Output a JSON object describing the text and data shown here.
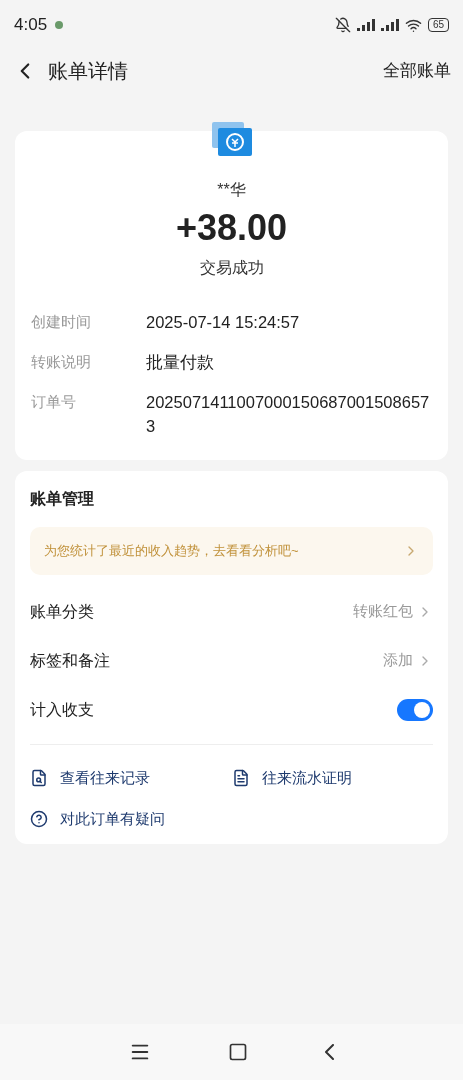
{
  "status_bar": {
    "time": "4:05",
    "battery": "65"
  },
  "header": {
    "title": "账单详情",
    "action": "全部账单"
  },
  "summary": {
    "counterparty": "**华",
    "amount": "+38.00",
    "status": "交易成功",
    "details": [
      {
        "label": "创建时间",
        "value": "2025-07-14 15:24:57"
      },
      {
        "label": "转账说明",
        "value": "批量付款"
      },
      {
        "label": "订单号",
        "value": "20250714110070001506870015086573"
      }
    ]
  },
  "management": {
    "title": "账单管理",
    "banner": "为您统计了最近的收入趋势，去看看分析吧~",
    "rows": [
      {
        "kind": "link",
        "label": "账单分类",
        "value": "转账红包"
      },
      {
        "kind": "link",
        "label": "标签和备注",
        "value": "添加"
      },
      {
        "kind": "toggle",
        "label": "计入收支",
        "on": true
      }
    ],
    "actions": [
      {
        "kind": "records",
        "label": "查看往来记录"
      },
      {
        "kind": "proof",
        "label": "往来流水证明"
      },
      {
        "kind": "question",
        "label": "对此订单有疑问"
      }
    ]
  }
}
